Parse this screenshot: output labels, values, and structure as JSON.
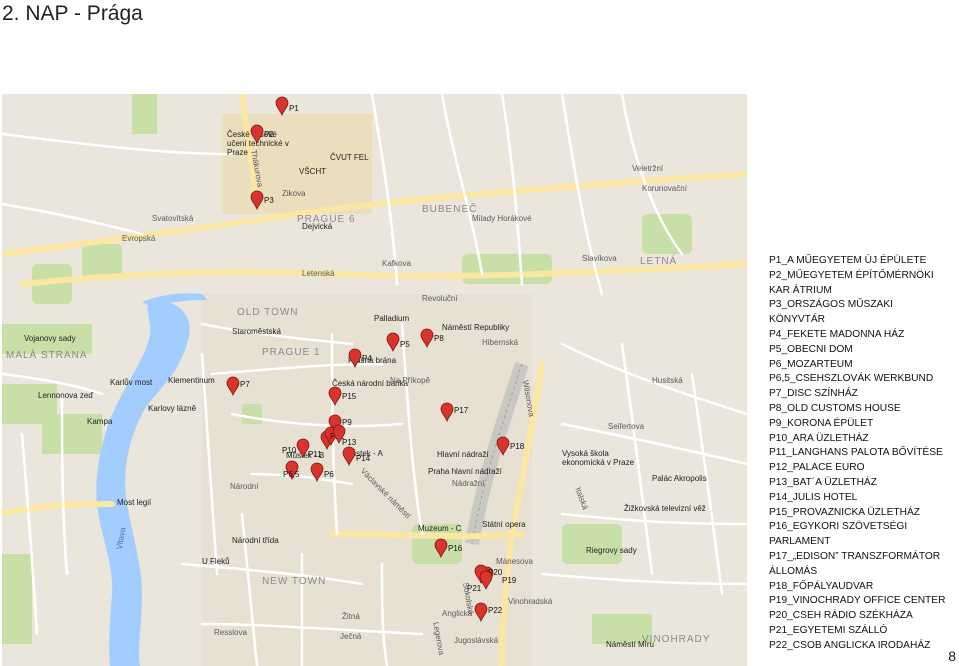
{
  "title": "2. NAP - Prága",
  "page_number": "8",
  "legend": [
    "P1_A MŰEGYETEM ÚJ ÉPÜLETE",
    "P2_MŰEGYETEM ÉPÍTŐMÉRNÖKI",
    "KAR ÁTRIUM",
    "P3_ORSZÁGOS MŰSZAKI",
    "KÖNYVTÁR",
    "P4_FEKETE MADONNA HÁZ",
    "P5_OBECNI DOM",
    "P6_MOZARTEUM",
    "P6,5_CSEHSZLOVÁK WERKBUND",
    "P7_DISC SZÍNHÁZ",
    "P8_OLD CUSTOMS HOUSE",
    "P9_KORONA ÉPÜLET",
    "P10_ARA ÜZLETHÁZ",
    "P11_LANGHANS PALOTA BŐVÍTÉSE",
    "P12_PALACE EURO",
    "P13_BAT´A ÜZLETHÁZ",
    "P14_JULIS HOTEL",
    "P15_PROVAZNICKA ÜZLETHÁZ",
    "P16_EGYKORI SZÖVETSÉGI",
    "PARLAMENT",
    "P17_„EDISON” TRANSZFORMÁTOR",
    "ÁLLOMÁS",
    "P18_FŐPÁLYAUDVAR",
    "P19_VINOCHRADY OFFICE CENTER",
    "P20_CSEH RÁDIO SZÉKHÁZA",
    "P21_EGYETEMI SZÁLLÓ",
    "P22_CSOB ANGLICKA IRODAHÁZ"
  ],
  "map": {
    "districts": [
      "PRAGUE 6",
      "BUBENEČ",
      "MALÁ STRANA",
      "PRAGUE 1",
      "OLD TOWN",
      "NEW TOWN",
      "LETNÁ",
      "VINOHRADY"
    ],
    "water": [
      "Vltava"
    ],
    "places": [
      "České vysoké učení technické v Praze",
      "ČVUT FEL",
      "VŠCHT",
      "Dejvická",
      "Palladium",
      "Náměstí Republiky",
      "Prašná brána",
      "Česká národní banka",
      "Staroměstská",
      "Můstek - B",
      "Můstek - A",
      "Hlavní nádraží",
      "Praha hlavní nádraží",
      "Muzeum - C",
      "Státní opera",
      "Národní třída",
      "Karlův most",
      "Klementinum",
      "Karlovy lázně",
      "Kampa",
      "Most legií",
      "U Fleků",
      "Náměstí Míru",
      "Riegrovy sady",
      "Palác Akropolis",
      "Žižkovská televizní věž",
      "Vysoká škola ekonomická v Praze",
      "Lennonova zeď",
      "Vojanovy sady",
      "Hibernská",
      "Husitská",
      "Italská",
      "Nádražní",
      "Wilsonova",
      "Seifertova",
      "Vinohradská",
      "Ječná",
      "Resslova",
      "Legerova",
      "Sokolská",
      "Žitná",
      "Václavské náměstí",
      "Národní",
      "Na Příkopě",
      "Revoluční",
      "Milady Horákové",
      "Veletržní",
      "Letenská",
      "Thákurova",
      "Jugoslávská",
      "Anglická",
      "Mánesova",
      "Slavíkova",
      "Korunovační",
      "Kafkova",
      "Zikova",
      "Evropská",
      "Svatovítská"
    ],
    "markers": [
      {
        "id": "P1",
        "label": "P1"
      },
      {
        "id": "P2",
        "label": "P2"
      },
      {
        "id": "P3",
        "label": "P3"
      },
      {
        "id": "P4",
        "label": "P4"
      },
      {
        "id": "P5",
        "label": "P5"
      },
      {
        "id": "P6",
        "label": "P6"
      },
      {
        "id": "P6.5",
        "label": "P6,5"
      },
      {
        "id": "P7",
        "label": "P7"
      },
      {
        "id": "P8",
        "label": "P8"
      },
      {
        "id": "P9",
        "label": "P9"
      },
      {
        "id": "P10",
        "label": "P10"
      },
      {
        "id": "P11",
        "label": "P11"
      },
      {
        "id": "P12",
        "label": "P12"
      },
      {
        "id": "P13",
        "label": "P13"
      },
      {
        "id": "P14",
        "label": "P14"
      },
      {
        "id": "P15",
        "label": "P15"
      },
      {
        "id": "P16",
        "label": "P16"
      },
      {
        "id": "P17",
        "label": "P17"
      },
      {
        "id": "P18",
        "label": "P18"
      },
      {
        "id": "P19",
        "label": "P19"
      },
      {
        "id": "P20",
        "label": "P20"
      },
      {
        "id": "P21",
        "label": "P21"
      },
      {
        "id": "P22",
        "label": "P22"
      }
    ],
    "colors": {
      "water": "#a3ccff",
      "park": "#c8dfa8",
      "road": "#ffffff",
      "major_road": "#fbe7a1",
      "land": "#ebe6dc",
      "marker": "#d9342b"
    }
  }
}
